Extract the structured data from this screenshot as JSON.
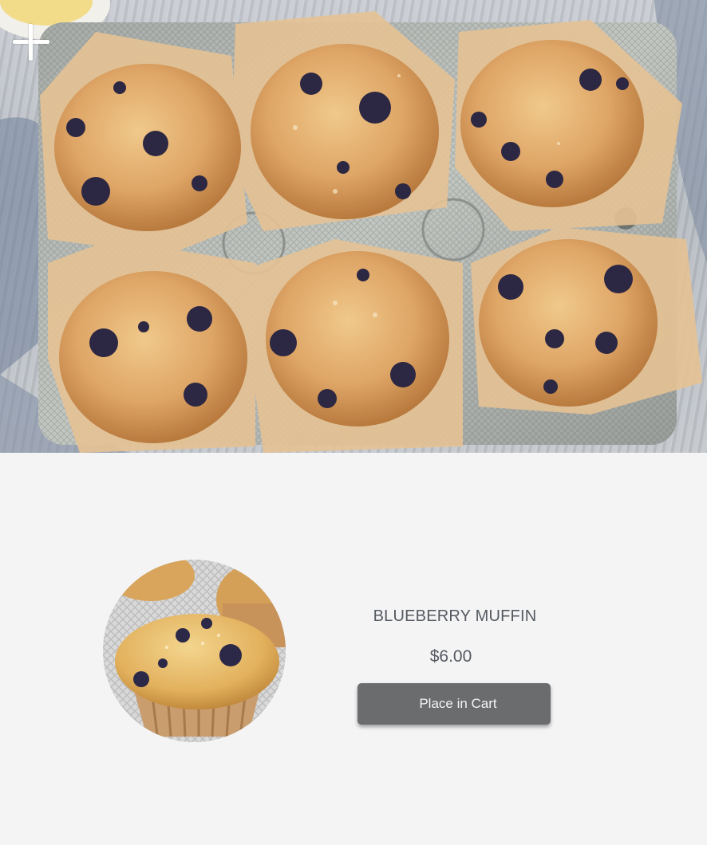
{
  "hero": {
    "image": "blueberry-muffins-tray-photo",
    "add_icon": "plus-icon"
  },
  "product": {
    "image": "blueberry-muffin-photo",
    "name": "BLUEBERRY MUFFIN",
    "price": "$6.00",
    "cart_button_label": "Place in Cart"
  },
  "colors": {
    "background": "#f4f4f5",
    "text": "#555a61",
    "button": "#6b6c6e",
    "button_text": "#f4f4f4"
  }
}
